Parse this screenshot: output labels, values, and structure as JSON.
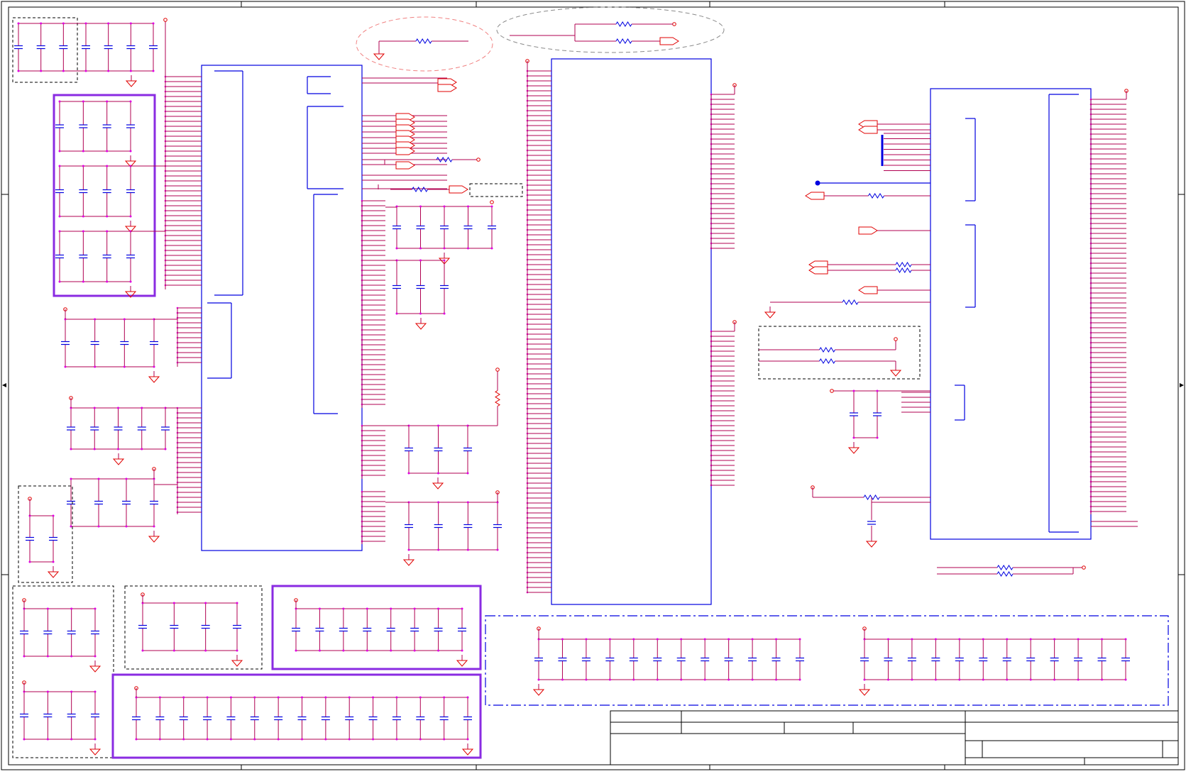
{
  "document": {
    "type": "schematic-sheet",
    "labels": []
  },
  "title_block": {
    "fields": []
  },
  "colors": {
    "frame": "#000000",
    "wire": "#b00050",
    "net_red": "#e00000",
    "pin_magenta": "#e000e0",
    "component_blue": "#0000e0",
    "group_purple": "#8a2be2",
    "dashed_gray": "#8a8a8a",
    "dashed_pink": "#f08080"
  },
  "components": {
    "ic_blocks": 4,
    "capacitor_groups": 20,
    "resistors": 14,
    "ground_symbols": 30
  }
}
